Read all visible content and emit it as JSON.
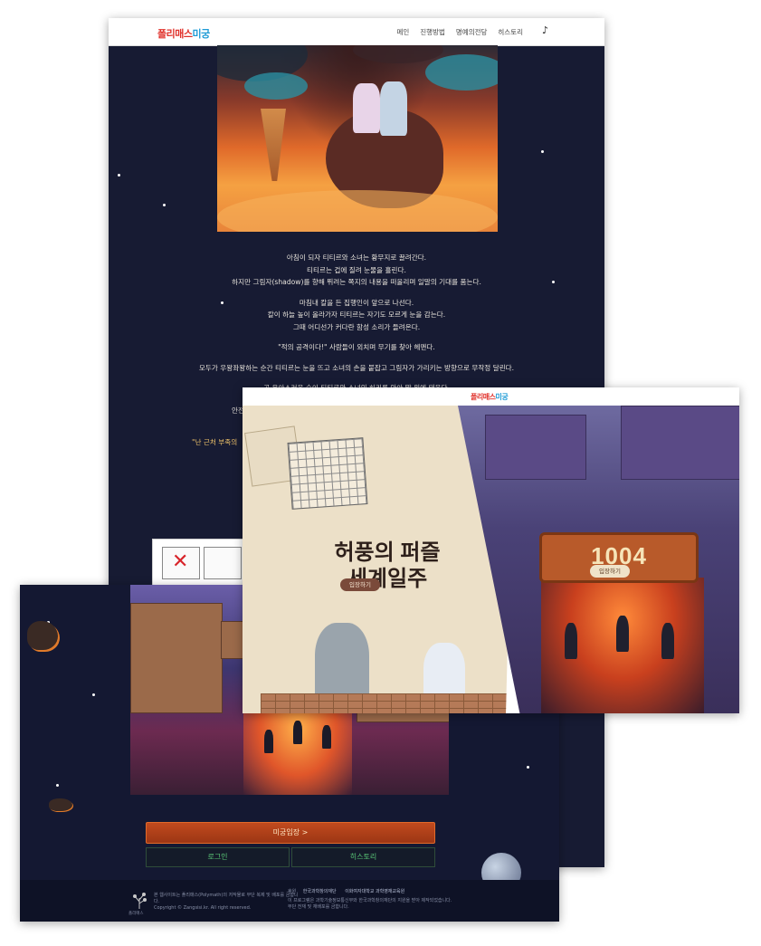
{
  "brand": {
    "logo_part1": "폴리매스",
    "logo_part2": "미궁",
    "logo_color_1": "#e0312b",
    "logo_color_2": "#1e9bd6"
  },
  "story_page": {
    "nav": [
      "메인",
      "진행방법",
      "명예의전당",
      "히스토리"
    ],
    "music_icon": "music-note-icon",
    "paragraphs": [
      [
        "아침이 되자 티티르와 소녀는 황무지로 끌려간다.",
        "티티르는 겁에 질려 눈물을 흘린다.",
        "하지만 그림자(shadow)를 향해 뛰려는 쪽지의 내용을 떠올리며 일말의 기대를 품는다."
      ],
      [
        "마침내 칼을 든 집행인이 앞으로 나선다.",
        "칼이 하늘 높이 올라가자 티티르는 자기도 모르게 눈을 감는다.",
        "그때 어디선가 커다란 함성 소리가 들려온다."
      ],
      [
        "\"적의 공격이다!\" 사람들이 외치며 무기를 찾아 헤맨다."
      ],
      [
        "모두가 우왕좌왕하는 순간 티티르는 눈을 뜨고 소녀의 손을 붙잡고 그림자가 가리키는 방향으로 무작정 달린다."
      ],
      [
        "곧 우아스러운 숲이 티티르와 소녀의 허리를 안아 말 위에 태운다."
      ]
    ],
    "partial_line_1": "안전",
    "partial_line_2": "\"난 근처 부족의"
  },
  "maze_page": {
    "enter_button": "미궁입장 >",
    "login_button": "로그인",
    "history_button": "히스토리",
    "footer_left_logo": "폴리매스",
    "footer_left_text": [
      "본 웹사이트는 폴리매스(Polymath)의 저작물로 무단 복제 및 배포를 금합니다.",
      "Copyright © Zangsisi.kr. All right reserved."
    ],
    "footer_sponsor_label": "후원",
    "footer_sponsor_1": "한국과학창의재단",
    "footer_sponsor_2": "이화여자대학교 과학영재교육원",
    "footer_right_text": [
      "이 프로그램은 과학기술정보통신부와 한국과학창의재단의 지원을 받아 제작되었습니다.",
      "무단 전재 및 재배포를 금합니다."
    ]
  },
  "tour_page": {
    "title_line1": "허풍의 퍼즐",
    "title_line2": "세계일주",
    "tour_enter_button": "입장하기",
    "maze_number": "1004",
    "maze_enter_button": "입장하기"
  }
}
